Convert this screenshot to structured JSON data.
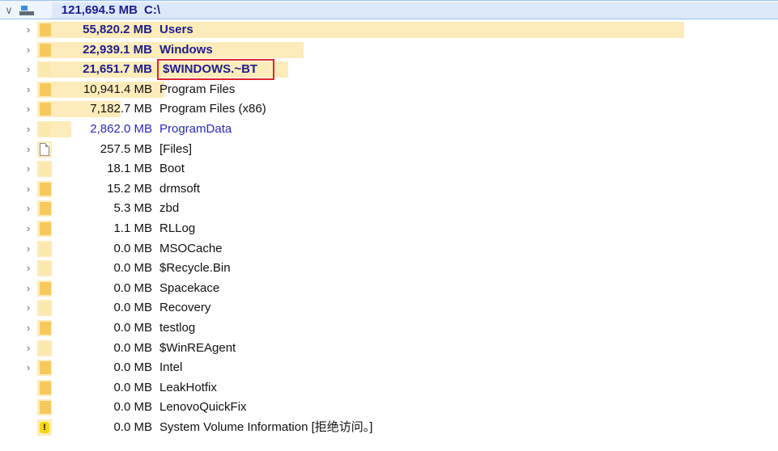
{
  "root": {
    "size": "121,694.5 MB",
    "name": "C:\\",
    "expander": "∨"
  },
  "warning_glyph": "!",
  "rows": [
    {
      "size": "55,820.2 MB",
      "name": "Users",
      "style": "bold",
      "icon": "folder",
      "expandable": true,
      "share": 0.459
    },
    {
      "size": "22,939.1 MB",
      "name": "Windows",
      "style": "bold",
      "icon": "folder",
      "expandable": true,
      "share": 0.189
    },
    {
      "size": "21,651.7 MB",
      "name": "$WINDOWS.~BT",
      "style": "bold",
      "icon": "folder-light",
      "expandable": true,
      "share": 0.178,
      "highlighted": true
    },
    {
      "size": "10,941.4 MB",
      "name": "Program Files",
      "style": "normal",
      "icon": "folder",
      "expandable": true,
      "share": 0.09
    },
    {
      "size": "7,182.7 MB",
      "name": "Program Files (x86)",
      "style": "normal",
      "icon": "folder",
      "expandable": true,
      "share": 0.059
    },
    {
      "size": "2,862.0 MB",
      "name": "ProgramData",
      "style": "blue",
      "icon": "folder-light",
      "expandable": true,
      "share": 0.024
    },
    {
      "size": "257.5 MB",
      "name": "[Files]",
      "style": "normal",
      "icon": "file",
      "expandable": true,
      "share": 0.002
    },
    {
      "size": "18.1 MB",
      "name": "Boot",
      "style": "normal",
      "icon": "folder-light",
      "expandable": true,
      "share": 0
    },
    {
      "size": "15.2 MB",
      "name": "drmsoft",
      "style": "normal",
      "icon": "folder",
      "expandable": true,
      "share": 0
    },
    {
      "size": "5.3 MB",
      "name": "zbd",
      "style": "normal",
      "icon": "folder",
      "expandable": true,
      "share": 0
    },
    {
      "size": "1.1 MB",
      "name": "RLLog",
      "style": "normal",
      "icon": "folder",
      "expandable": true,
      "share": 0
    },
    {
      "size": "0.0 MB",
      "name": "MSOCache",
      "style": "normal",
      "icon": "folder-light",
      "expandable": true,
      "share": 0
    },
    {
      "size": "0.0 MB",
      "name": "$Recycle.Bin",
      "style": "normal",
      "icon": "folder-light",
      "expandable": true,
      "share": 0
    },
    {
      "size": "0.0 MB",
      "name": "Spacekace",
      "style": "normal",
      "icon": "folder",
      "expandable": true,
      "share": 0
    },
    {
      "size": "0.0 MB",
      "name": "Recovery",
      "style": "normal",
      "icon": "folder-light",
      "expandable": true,
      "share": 0
    },
    {
      "size": "0.0 MB",
      "name": "testlog",
      "style": "normal",
      "icon": "folder",
      "expandable": true,
      "share": 0
    },
    {
      "size": "0.0 MB",
      "name": "$WinREAgent",
      "style": "normal",
      "icon": "folder-light",
      "expandable": true,
      "share": 0
    },
    {
      "size": "0.0 MB",
      "name": "Intel",
      "style": "normal",
      "icon": "folder",
      "expandable": true,
      "share": 0
    },
    {
      "size": "0.0 MB",
      "name": "LeakHotfix",
      "style": "normal",
      "icon": "folder",
      "expandable": false,
      "share": 0
    },
    {
      "size": "0.0 MB",
      "name": "LenovoQuickFix",
      "style": "normal",
      "icon": "folder",
      "expandable": false,
      "share": 0
    },
    {
      "size": "0.0 MB",
      "name": "System Volume Information  [拒绝访问。]",
      "style": "normal",
      "icon": "warning",
      "expandable": false,
      "share": 0
    }
  ],
  "colors": {
    "bar": "#fdecb9",
    "root_bar": "#dde9f8",
    "bold_text": "#1d1d8e",
    "blue_text": "#2a2ab8",
    "highlight_border": "#e0232c"
  }
}
